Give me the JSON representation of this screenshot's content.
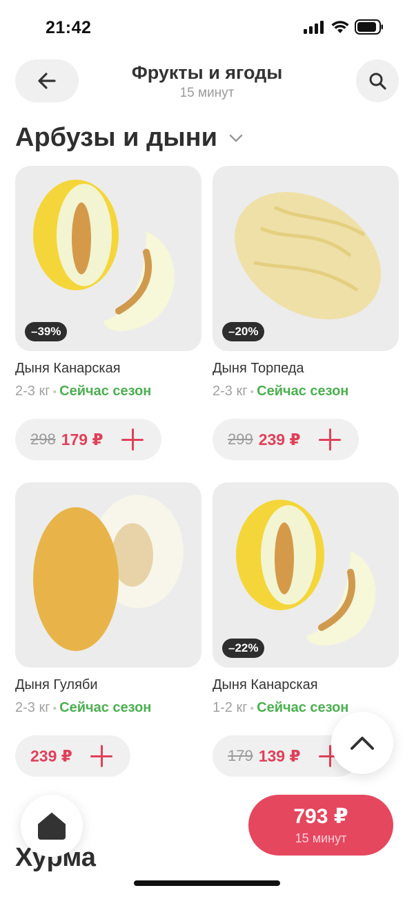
{
  "status_bar": {
    "time": "21:42",
    "icons": [
      "signal-icon",
      "wifi-icon",
      "battery-icon"
    ]
  },
  "header": {
    "title": "Фрукты и ягоды",
    "subtitle": "15 минут",
    "back_icon": "arrow-left-icon",
    "search_icon": "search-icon"
  },
  "section": {
    "title": "Арбузы и дыни",
    "chevron_icon": "chevron-down-icon"
  },
  "products": [
    {
      "name": "Дыня Канарская",
      "weight": "2-3 кг",
      "season": "Сейчас сезон",
      "discount": "–39%",
      "old_price": "298",
      "price": "179 ₽"
    },
    {
      "name": "Дыня Торпеда",
      "weight": "2-3 кг",
      "season": "Сейчас сезон",
      "discount": "–20%",
      "old_price": "299",
      "price": "239 ₽"
    },
    {
      "name": "Дыня Гуляби",
      "weight": "2-3 кг",
      "season": "Сейчас сезон",
      "discount": "",
      "old_price": "",
      "price": "239 ₽"
    },
    {
      "name": "Дыня Канарская",
      "weight": "1-2 кг",
      "season": "Сейчас сезон",
      "discount": "–22%",
      "old_price": "179",
      "price": "139 ₽"
    }
  ],
  "next_section": {
    "title": "Хурма"
  },
  "cart": {
    "total": "793 ₽",
    "time": "15 минут"
  },
  "colors": {
    "accent": "#e5475f",
    "price": "#e0405a",
    "season": "#4caf50",
    "pill_bg": "#f0f0f0"
  }
}
